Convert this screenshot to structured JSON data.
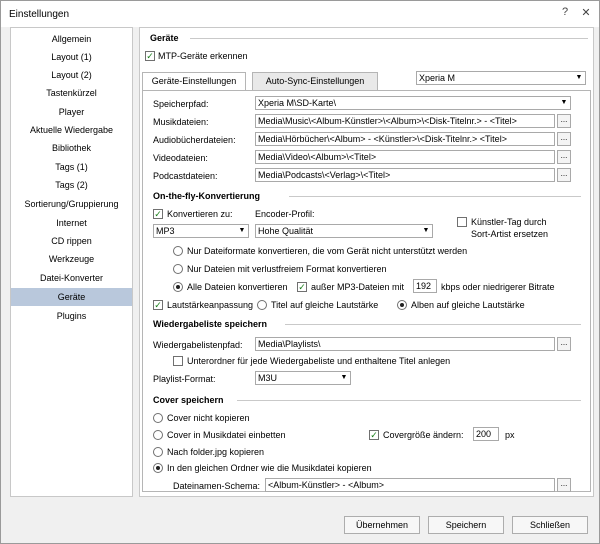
{
  "window": {
    "title": "Einstellungen",
    "help_glyph": "?",
    "close_glyph": "✕"
  },
  "sidebar": {
    "items": [
      {
        "label": "Allgemein"
      },
      {
        "label": "Layout (1)"
      },
      {
        "label": "Layout (2)"
      },
      {
        "label": "Tastenkürzel"
      },
      {
        "label": "Player"
      },
      {
        "label": "Aktuelle Wiedergabe"
      },
      {
        "label": "Bibliothek"
      },
      {
        "label": "Tags (1)"
      },
      {
        "label": "Tags (2)"
      },
      {
        "label": "Sortierung/Gruppierung"
      },
      {
        "label": "Internet"
      },
      {
        "label": "CD rippen"
      },
      {
        "label": "Werkzeuge"
      },
      {
        "label": "Datei-Konverter"
      },
      {
        "label": "Geräte"
      },
      {
        "label": "Plugins"
      }
    ],
    "selected": "Geräte"
  },
  "devices": {
    "heading": "Geräte",
    "mtp_label": "MTP-Geräte erkennen",
    "mtp_checked": true,
    "tabs": [
      "Geräte-Einstellungen",
      "Auto-Sync-Einstellungen"
    ],
    "device_select": "Xperia M",
    "storage_label": "Speicherpfad:",
    "storage_value": "Xperia M\\SD-Karte\\",
    "music_label": "Musikdateien:",
    "music_value": "Media\\Music\\<Album-Künstler>\\<Album>\\<Disk-Titelnr.> - <Titel>",
    "audiobook_label": "Audiobücherdateien:",
    "audiobook_value": "Media\\Hörbücher\\<Album> - <Künstler>\\<Disk-Titelnr.> <Titel>",
    "video_label": "Videodateien:",
    "video_value": "Media\\Video\\<Album>\\<Titel>",
    "podcast_label": "Podcastdateien:",
    "podcast_value": "Media\\Podcasts\\<Verlag>\\<Titel>",
    "browse_glyph": "..."
  },
  "onthefly": {
    "heading": "On-the-fly-Konvertierung",
    "convert_label": "Konvertieren zu:",
    "convert_checked": true,
    "format_value": "MP3",
    "encoder_label": "Encoder-Profil:",
    "encoder_value": "Hohe Qualität",
    "artist_tag_label_1": "Künstler-Tag durch",
    "artist_tag_label_2": "Sort-Artist ersetzen",
    "artist_tag_checked": false,
    "radio_unsupported": "Nur Dateiformate konvertieren, die vom Gerät nicht unterstützt werden",
    "radio_lossless": "Nur Dateien mit verlustfreiem Format konvertieren",
    "radio_all": "Alle Dateien konvertieren",
    "except_mp3_label": "außer MP3-Dateien mit",
    "except_mp3_checked": true,
    "bitrate_value": "192",
    "bitrate_suffix": "kbps oder niedrigerer Bitrate",
    "volume_label": "Lautstärkeanpassung",
    "volume_checked": true,
    "title_volume": "Titel auf gleiche Lautstärke",
    "album_volume": "Alben auf gleiche Lautstärke"
  },
  "playlist": {
    "heading": "Wiedergabeliste speichern",
    "path_label": "Wiedergabelistenpfad:",
    "path_value": "Media\\Playlists\\",
    "subfolder_label": "Unterordner für jede Wiedergabeliste und enthaltene Titel anlegen",
    "subfolder_checked": false,
    "format_label": "Playlist-Format:",
    "format_value": "M3U"
  },
  "cover": {
    "heading": "Cover speichern",
    "opt_none": "Cover nicht kopieren",
    "opt_embed": "Cover in Musikdatei einbetten",
    "opt_folder": "Nach folder.jpg kopieren",
    "opt_same": "In den gleichen Ordner wie die Musikdatei kopieren",
    "size_label": "Covergröße ändern:",
    "size_checked": true,
    "size_value": "200",
    "size_unit": "px",
    "schema_label": "Dateinamen-Schema:",
    "schema_value": "<Album-Künstler> - <Album>"
  },
  "footer": {
    "apply_label": "Übernehmen",
    "save_label": "Speichern",
    "close_label": "Schließen"
  }
}
